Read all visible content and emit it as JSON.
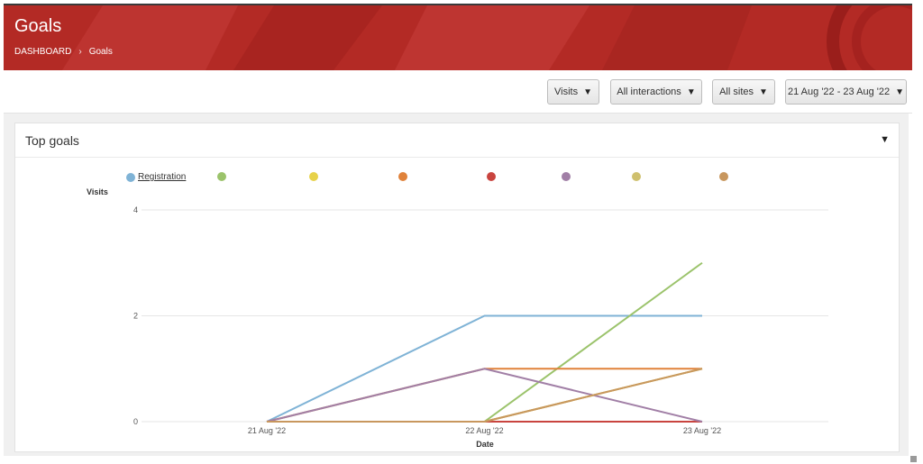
{
  "header": {
    "title": "Goals",
    "breadcrumb": [
      "DASHBOARD",
      "Goals"
    ],
    "background_color": "#b32a25"
  },
  "toolbar": {
    "metric": "Visits",
    "interactions": "All interactions",
    "sites": "All sites",
    "date_range": "21 Aug '22 - 23 Aug '22"
  },
  "panel": {
    "title": "Top goals"
  },
  "chart_data": {
    "type": "line",
    "ylabel": "Visits",
    "xlabel": "Date",
    "x": [
      "21 Aug '22",
      "22 Aug '22",
      "23 Aug '22"
    ],
    "yticks": [
      "0",
      "2",
      "4"
    ],
    "ylim": [
      0,
      4
    ],
    "grid": true,
    "legend_position": "top",
    "series": [
      {
        "name": "Registration",
        "color": "#7fb3d6",
        "values": [
          0,
          2,
          2
        ]
      },
      {
        "color": "#9bc36b",
        "values": [
          0,
          0,
          3
        ]
      },
      {
        "color": "#e7d24a",
        "values": [
          0,
          0,
          1
        ]
      },
      {
        "color": "#e0823a",
        "values": [
          0,
          1,
          1
        ]
      },
      {
        "color": "#c9443f",
        "values": [
          0,
          0,
          0
        ]
      },
      {
        "color": "#a17fa6",
        "values": [
          0,
          1,
          0
        ]
      },
      {
        "color": "#cfc06e",
        "values": [
          0,
          0,
          1
        ]
      },
      {
        "color": "#c8975e",
        "values": [
          0,
          0,
          1
        ]
      }
    ]
  }
}
